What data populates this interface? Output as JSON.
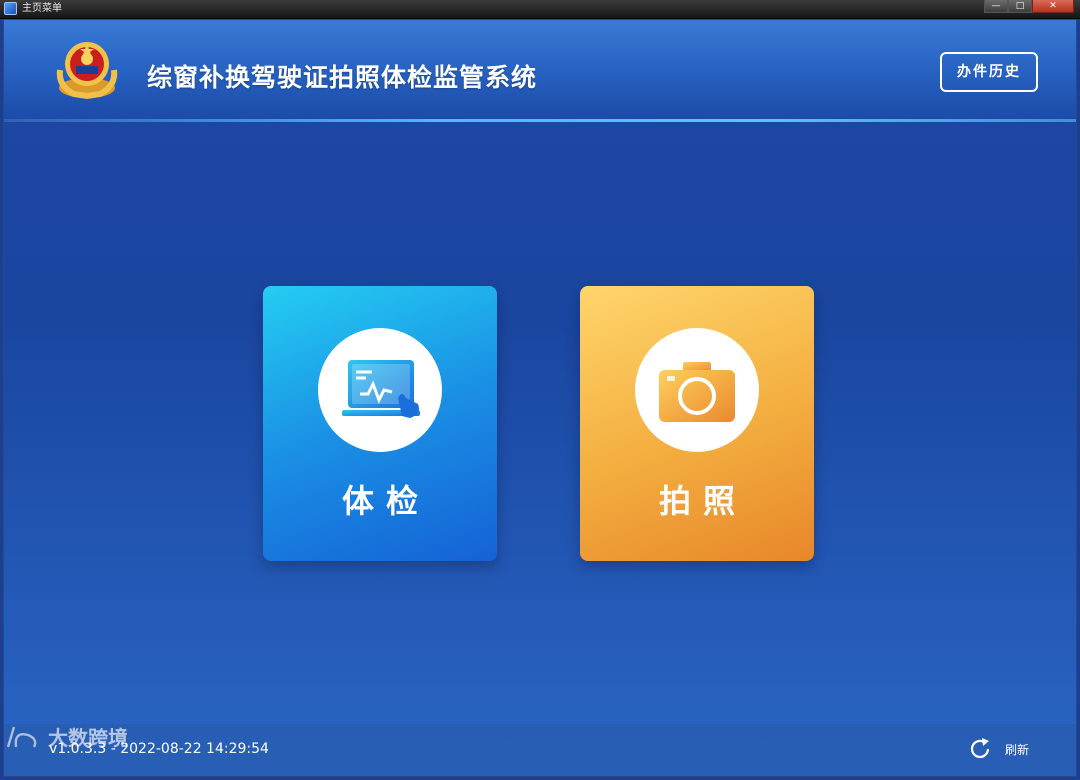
{
  "window": {
    "title": "主页菜单",
    "minimize": "—",
    "maximize": "□",
    "close": "✕"
  },
  "header": {
    "title": "综窗补换驾驶证拍照体检监管系统",
    "history_button": "办件历史",
    "emblem_icon": "police-emblem"
  },
  "cards": [
    {
      "label": "体检",
      "icon": "monitor-chart-icon",
      "color": "#1a8fe4"
    },
    {
      "label": "拍照",
      "icon": "camera-icon",
      "color": "#f3ad3f"
    }
  ],
  "footer": {
    "version": "v1.0.3.3",
    "datetime": "2022-08-22 14:29:54",
    "refresh_label": "刷新"
  },
  "watermark": {
    "text": "大数跨境"
  }
}
